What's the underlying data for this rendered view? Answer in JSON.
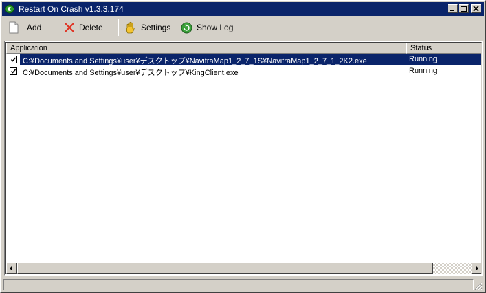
{
  "window": {
    "title": "Restart On Crash v1.3.3.174",
    "app_icon": "restart-on-crash-icon",
    "title_bg": "#0a246a"
  },
  "toolbar": {
    "add_label": "Add",
    "delete_label": "Delete",
    "settings_label": "Settings",
    "showlog_label": "Show Log",
    "icons": {
      "add": "new-document-icon",
      "delete": "red-x-icon",
      "settings": "hand-icon",
      "showlog": "green-refresh-icon"
    }
  },
  "list": {
    "columns": [
      "Application",
      "Status"
    ],
    "rows": [
      {
        "checked": true,
        "selected": true,
        "application": "C:¥Documents and Settings¥user¥デスクトップ¥NavitraMap1_2_7_1S¥NavitraMap1_2_7_1_2K2.exe",
        "status": "Running"
      },
      {
        "checked": true,
        "selected": false,
        "application": "C:¥Documents and Settings¥user¥デスクトップ¥KingClient.exe",
        "status": "Running"
      }
    ]
  },
  "colors": {
    "selection": "#0a246a",
    "face": "#d4d0c8"
  }
}
